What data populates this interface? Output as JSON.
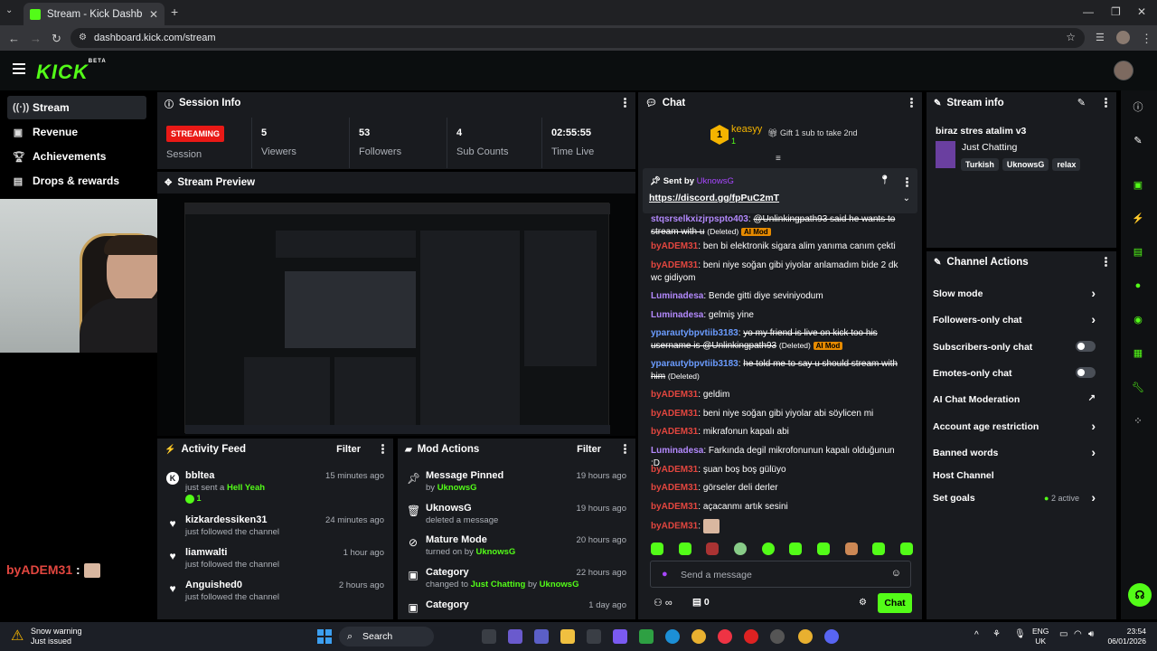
{
  "browser": {
    "tab_title": "Stream - Kick Dashboard",
    "url": "dashboard.kick.com/stream"
  },
  "app": {
    "logo": "KICK",
    "logo_badge": "BETA"
  },
  "sidebar": {
    "items": [
      {
        "label": "Stream",
        "icon": "broadcast-icon",
        "active": true
      },
      {
        "label": "Revenue",
        "icon": "revenue-icon"
      },
      {
        "label": "Achievements",
        "icon": "trophy-icon"
      },
      {
        "label": "Drops & rewards",
        "icon": "drops-icon"
      }
    ]
  },
  "overlay_chat": {
    "user": "byADEM31",
    "sep": ":"
  },
  "session": {
    "title": "Session Info",
    "status": "STREAMING",
    "status_label": "Session",
    "stats": [
      {
        "value": "5",
        "label": "Viewers"
      },
      {
        "value": "53",
        "label": "Followers"
      },
      {
        "value": "4",
        "label": "Sub Counts"
      },
      {
        "value": "02:55:55",
        "label": "Time Live"
      }
    ]
  },
  "preview": {
    "title": "Stream Preview"
  },
  "activity": {
    "title": "Activity Feed",
    "filter": "Filter",
    "items": [
      {
        "name": "bbltea",
        "time": "15 minutes ago",
        "sub_pre": "just sent a ",
        "sub_hl": "Hell Yeah",
        "count": "1",
        "icon": "kick-icon"
      },
      {
        "name": "kizkardessiken31",
        "time": "24 minutes ago",
        "sub": "just followed the channel",
        "icon": "heart-icon"
      },
      {
        "name": "liamwalti",
        "time": "1 hour ago",
        "sub": "just followed the channel",
        "icon": "heart-icon"
      },
      {
        "name": "Anguished0",
        "time": "2 hours ago",
        "sub": "just followed the channel",
        "icon": "heart-icon"
      }
    ]
  },
  "mod": {
    "title": "Mod Actions",
    "filter": "Filter",
    "items": [
      {
        "name": "Message Pinned",
        "time": "19 hours ago",
        "sub_pre": "by ",
        "sub_hl": "UknowsG",
        "icon": "pin-icon"
      },
      {
        "name": "UknowsG",
        "time": "19 hours ago",
        "sub_pre": "deleted a message",
        "sub_hl": "",
        "icon": "trash-icon"
      },
      {
        "name": "Mature Mode",
        "time": "20 hours ago",
        "sub_pre": "turned on by ",
        "sub_hl": "UknowsG",
        "icon": "eye-off-icon"
      },
      {
        "name": "Category",
        "time": "22 hours ago",
        "sub_pre": "changed to ",
        "sub_hl": "Just Chatting",
        "sub_mid": " by ",
        "sub_hl2": "UknowsG",
        "icon": "category-icon"
      },
      {
        "name": "Category",
        "time": "1 day ago",
        "icon": "category-icon"
      }
    ]
  },
  "chat": {
    "title": "Chat",
    "gifter": {
      "name": "keasyy",
      "count": "1",
      "rank": "1",
      "gift_text": "Gift 1 sub to take 2nd"
    },
    "pinned": {
      "label": "Sent by",
      "user": "UknowsG",
      "link": "https://discord.gg/fpPuC2mT"
    },
    "messages": [
      {
        "user": "stqsrselkxizjrpspto403",
        "text": "@Unlinkingpath93 said he wants to stream with u",
        "deleted": true,
        "badge": "AI Mod",
        "tag": "(Deleted)",
        "color": "purple"
      },
      {
        "user": "byADEM31",
        "text": "ben bi elektronik sigara alim yanıma canım çekti",
        "color": "red"
      },
      {
        "user": "byADEM31",
        "text": "beni niye soğan gibi yiyolar anlamadım bide 2 dk wc gidiyom",
        "color": "red"
      },
      {
        "user": "Luminadesa",
        "text": "Bende gitti diye seviniyodum",
        "color": "purple"
      },
      {
        "user": "Luminadesa",
        "text": "gelmiş yine",
        "color": "purple"
      },
      {
        "user": "yparautybpvtiib3183",
        "text": "yo my friend is live on kick too his username is @Unlinkingpath93",
        "deleted": true,
        "tag": "(Deleted)",
        "badge": "AI Mod",
        "color": "blue"
      },
      {
        "user": "yparautybpvtiib3183",
        "text": "he told me to say u should stream with him",
        "deleted": true,
        "tag": "(Deleted)",
        "color": "blue"
      },
      {
        "user": "byADEM31",
        "text": "geldim",
        "color": "red"
      },
      {
        "user": "byADEM31",
        "text": "beni niye soğan gibi yiyolar abi söylicen mi",
        "color": "red"
      },
      {
        "user": "byADEM31",
        "text": "mikrafonun kapalı abi",
        "color": "red"
      },
      {
        "user": "Luminadesa",
        "text": "Farkında degil mikrofonunun kapalı olduğunun :D",
        "color": "purple"
      },
      {
        "user": "byADEM31",
        "text": "şuan boş boş gülüyo",
        "color": "red"
      },
      {
        "user": "byADEM31",
        "text": "görseler deli derler",
        "color": "red"
      },
      {
        "user": "byADEM31",
        "text": "açacanmı artık sesini",
        "color": "red"
      },
      {
        "user": "byADEM31",
        "text": "",
        "color": "red"
      }
    ],
    "placeholder": "Send a message",
    "points": "0",
    "send": "Chat"
  },
  "stream_info": {
    "title": "Stream info",
    "stream_title": "biraz stres atalim v3",
    "category": "Just Chatting",
    "tags": [
      "Turkish",
      "UknowsG",
      "relax"
    ]
  },
  "channel_actions": {
    "title": "Channel Actions",
    "items": [
      {
        "label": "Slow mode",
        "type": "chevron"
      },
      {
        "label": "Followers-only chat",
        "type": "chevron"
      },
      {
        "label": "Subscribers-only chat",
        "type": "toggle"
      },
      {
        "label": "Emotes-only chat",
        "type": "toggle"
      },
      {
        "label": "AI Chat Moderation",
        "type": "external"
      },
      {
        "label": "Account age restriction",
        "type": "chevron"
      },
      {
        "label": "Banned words",
        "type": "chevron"
      },
      {
        "label": "Host Channel",
        "type": "none"
      },
      {
        "label": "Set goals",
        "type": "chevron",
        "extra": "2 active"
      }
    ]
  },
  "taskbar": {
    "weather": "Snow warning",
    "weather_sub": "Just issued",
    "search": "Search",
    "lang": "ENG",
    "region": "UK",
    "time": "23:54",
    "date": "06/01/2026"
  },
  "colors": {
    "accent": "#53fc18",
    "panel": "#191b1f",
    "live": "#e91916"
  }
}
